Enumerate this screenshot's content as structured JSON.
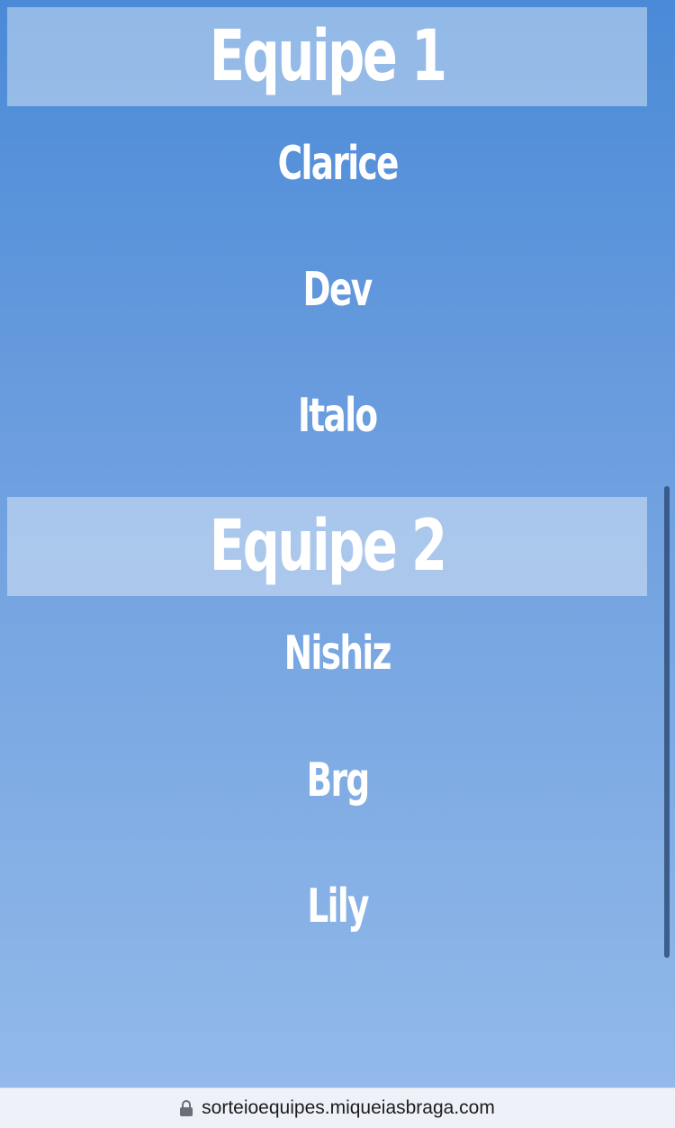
{
  "teams": [
    {
      "title": "Equipe 1",
      "members": [
        "Clarice",
        "Dev",
        "Italo"
      ]
    },
    {
      "title": "Equipe 2",
      "members": [
        "Nishiz",
        "Brg",
        "Lily"
      ]
    }
  ],
  "browser": {
    "url": "sorteioequipes.miqueiasbraga.com",
    "lock_icon": "lock-icon"
  },
  "colors": {
    "gradient_top": "#4a8ad7",
    "gradient_bottom": "#92b9e9",
    "header_band": "rgba(255,255,255,0.40)",
    "text": "#ffffff"
  }
}
